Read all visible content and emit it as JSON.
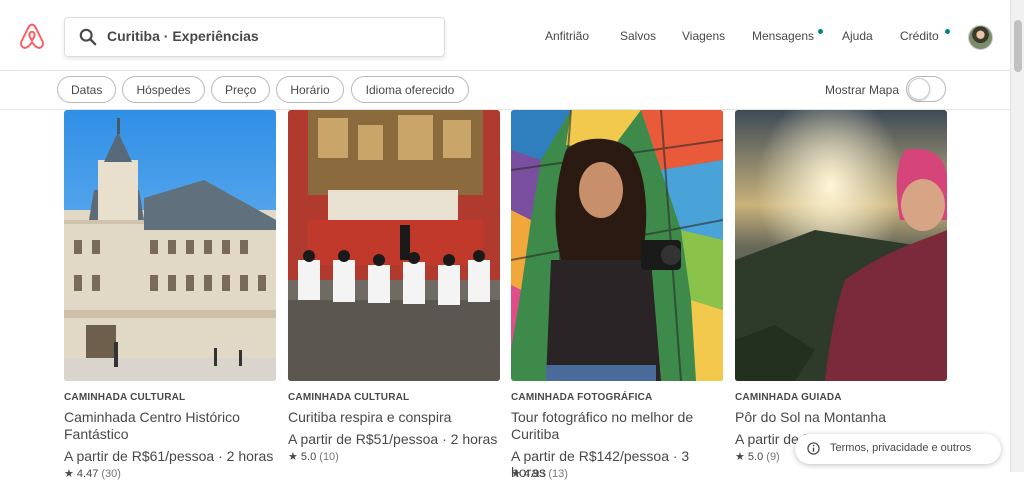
{
  "header": {
    "search_text": "Curitiba · Experiências",
    "nav": [
      "Anfitrião",
      "Salvos",
      "Viagens",
      "Mensagens",
      "Ajuda",
      "Crédito"
    ]
  },
  "filters": {
    "chips": [
      "Datas",
      "Hóspedes",
      "Preço",
      "Horário",
      "Idioma oferecido"
    ],
    "map_label": "Mostrar Mapa",
    "map_toggle_on": false
  },
  "cards": [
    {
      "category": "CAMINHADA CULTURAL",
      "title": "Caminhada Centro Histórico Fantástico",
      "price": "A partir de R$61/pessoa · 2 horas",
      "rating": "★ 4.47",
      "reviews": "(30)"
    },
    {
      "category": "CAMINHADA CULTURAL",
      "title": "Curitiba respira e conspira",
      "price": "A partir de R$51/pessoa · 2 horas",
      "rating": "★ 5.0",
      "reviews": "(10)"
    },
    {
      "category": "CAMINHADA FOTOGRÁFICA",
      "title": "Tour fotográfico no melhor de Curitiba",
      "price": "A partir de R$142/pessoa · 3 horas",
      "rating": "★ 4.93",
      "reviews": "(13)"
    },
    {
      "category": "CAMINHADA GUIADA",
      "title": "Pôr do Sol na Montanha",
      "price": "A partir de R$1…",
      "rating": "★ 5.0",
      "reviews": "(9)"
    }
  ],
  "footer": {
    "label": "Termos, privacidade e outros"
  },
  "colors": {
    "brand": "#FF5A5F",
    "accent_dot": "#008489",
    "text": "#484848"
  }
}
